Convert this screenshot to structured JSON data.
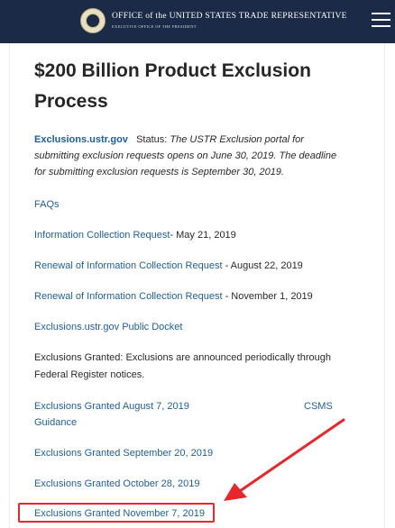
{
  "header": {
    "brand_line": "OFFICE of the UNITED STATES TRADE REPRESENTATIVE",
    "brand_subline": "EXECUTIVE OFFICE OF THE PRESIDENT",
    "menu_icon": "hamburger-menu-icon",
    "colors": {
      "bar": "#1b2a46",
      "text": "#ffffff"
    }
  },
  "page": {
    "title": "$200 Billion Product Exclusion Process",
    "status_link": "Exclusions.ustr.gov",
    "status_label": "Status:",
    "status_text": "The USTR Exclusion portal for submitting exclusion requests opens on June 30, 2019. The deadline for submitting exclusion requests is September 30, 2019."
  },
  "links": {
    "faqs": "FAQs",
    "info_request": "Information Collection Request",
    "info_request_date": "- May 21, 2019",
    "renewal_1": "Renewal of Information Collection Request",
    "renewal_1_date": " - August 22, 2019",
    "renewal_2": "Renewal of Information Collection Request",
    "renewal_2_date": " - November 1, 2019",
    "public_docket": "Exclusions.ustr.gov Public Docket"
  },
  "granted": {
    "note": "Exclusions Granted: Exclusions are announced periodically through Federal Register notices.",
    "items": [
      "Exclusions Granted August 7, 2019",
      "Exclusions Granted September 20, 2019",
      "Exclusions Granted October 28, 2019",
      "Exclusions Granted November 7, 2019"
    ],
    "csms": "CSMS",
    "guidance": "Guidance"
  },
  "annotation": {
    "color": "#e8262b"
  },
  "colors": {
    "link": "#1f5e9c",
    "heading": "#262626"
  }
}
